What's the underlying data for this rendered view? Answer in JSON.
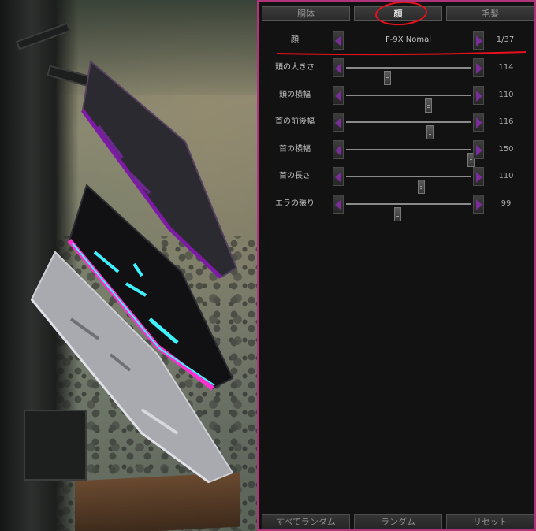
{
  "tabs": [
    {
      "label": "胴体",
      "active": false
    },
    {
      "label": "顔",
      "active": true
    },
    {
      "label": "毛髪",
      "active": false
    }
  ],
  "face_selector": {
    "label": "顔",
    "value": "F-9X Nomal",
    "counter": "1/37"
  },
  "sliders": [
    {
      "label": "頭の大きさ",
      "value": "114",
      "level": 0.33
    },
    {
      "label": "頭の横幅",
      "value": "110",
      "level": 0.66
    },
    {
      "label": "首の前後幅",
      "value": "116",
      "level": 0.67
    },
    {
      "label": "首の横幅",
      "value": "150",
      "level": 1.0
    },
    {
      "label": "首の長さ",
      "value": "110",
      "level": 0.6
    },
    {
      "label": "エラの張り",
      "value": "99",
      "level": 0.41
    }
  ],
  "bottom_buttons": {
    "all_random": "すべてランダム",
    "random": "ランダム",
    "reset": "リセット"
  },
  "colors": {
    "panel_border": "#b0347a",
    "arrow": "#7a2c98",
    "annotation": "#e8101a",
    "blade_glow_pink": "#ff2fd0",
    "blade_glow_cyan": "#3ff2ff"
  }
}
